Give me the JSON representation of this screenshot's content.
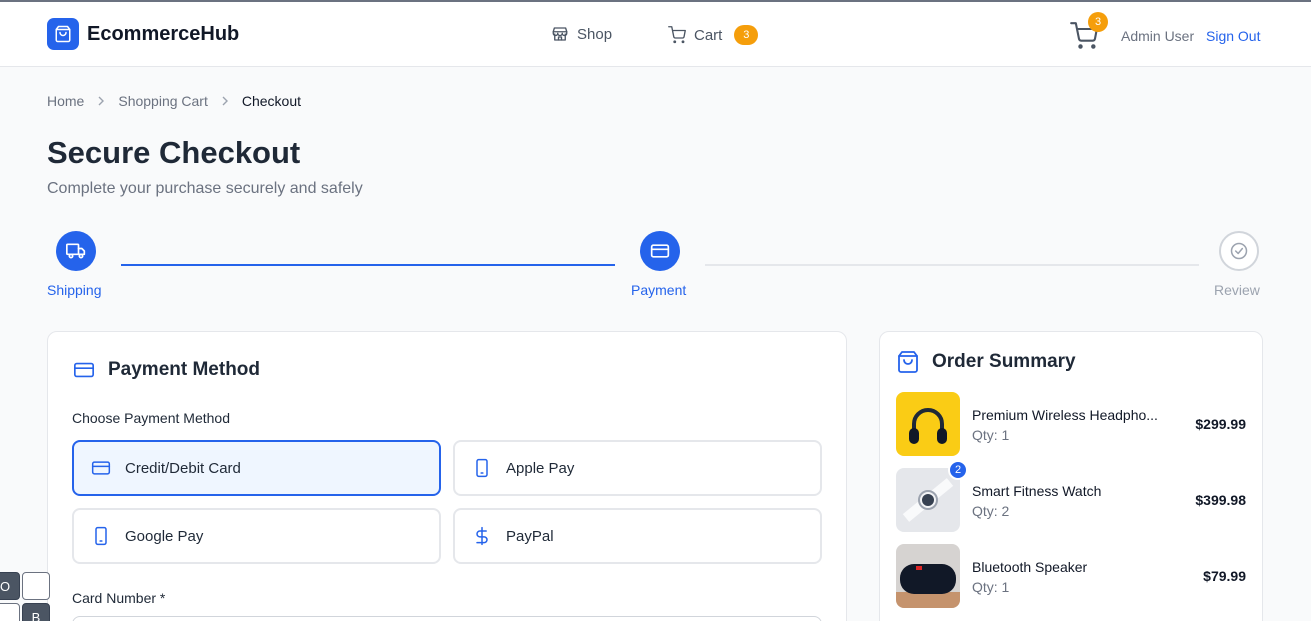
{
  "brand": {
    "name": "EcommerceHub"
  },
  "nav": {
    "shop": "Shop",
    "cart": "Cart",
    "cart_count": "3"
  },
  "header": {
    "cart_count": "3",
    "user": "Admin User",
    "sign_out": "Sign Out"
  },
  "breadcrumb": [
    "Home",
    "Shopping Cart",
    "Checkout"
  ],
  "page": {
    "title": "Secure Checkout",
    "subtitle": "Complete your purchase securely and safely"
  },
  "steps": [
    {
      "label": "Shipping",
      "state": "complete"
    },
    {
      "label": "Payment",
      "state": "active"
    },
    {
      "label": "Review",
      "state": "upcoming"
    }
  ],
  "payment": {
    "title": "Payment Method",
    "choose_label": "Choose Payment Method",
    "options": [
      {
        "label": "Credit/Debit Card",
        "icon": "credit-card-icon",
        "selected": true
      },
      {
        "label": "Apple Pay",
        "icon": "smartphone-icon",
        "selected": false
      },
      {
        "label": "Google Pay",
        "icon": "smartphone-icon",
        "selected": false
      },
      {
        "label": "PayPal",
        "icon": "dollar-icon",
        "selected": false
      }
    ],
    "card_number_label": "Card Number *"
  },
  "summary": {
    "title": "Order Summary",
    "items": [
      {
        "name": "Premium Wireless Headpho...",
        "qty": "Qty: 1",
        "price": "$299.99"
      },
      {
        "name": "Smart Fitness Watch",
        "qty": "Qty: 2",
        "price": "$399.98",
        "badge": "2"
      },
      {
        "name": "Bluetooth Speaker",
        "qty": "Qty: 1",
        "price": "$79.99"
      }
    ]
  },
  "keyboard": {
    "key1": "O",
    "key2": "B"
  },
  "colors": {
    "accent": "#2563eb",
    "badge": "#f59e0b",
    "muted": "#6b7280"
  }
}
